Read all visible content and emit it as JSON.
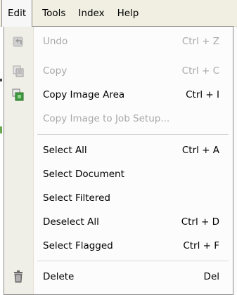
{
  "menubar": {
    "items": [
      {
        "label": "Edit"
      },
      {
        "label": "Tools"
      },
      {
        "label": "Index"
      },
      {
        "label": "Help"
      }
    ]
  },
  "edit_menu": {
    "items": [
      {
        "label": "Undo",
        "shortcut": "Ctrl + Z",
        "enabled": false,
        "icon": "undo-icon"
      },
      {
        "label": "Copy",
        "shortcut": "Ctrl + C",
        "enabled": false,
        "icon": "copy-icon"
      },
      {
        "label": "Copy Image Area",
        "shortcut": "Ctrl + I",
        "enabled": true,
        "icon": "copy-image-area-icon"
      },
      {
        "label": "Copy Image to Job Setup...",
        "shortcut": "",
        "enabled": false
      },
      {
        "label": "Select All",
        "shortcut": "Ctrl + A",
        "enabled": true
      },
      {
        "label": "Select Document",
        "shortcut": "",
        "enabled": true
      },
      {
        "label": "Select Filtered",
        "shortcut": "",
        "enabled": true
      },
      {
        "label": "Deselect All",
        "shortcut": "Ctrl + D",
        "enabled": true
      },
      {
        "label": "Select Flagged",
        "shortcut": "Ctrl + F",
        "enabled": true
      },
      {
        "label": "Delete",
        "shortcut": "Del",
        "enabled": true,
        "icon": "trash-icon"
      }
    ]
  },
  "colors": {
    "menubar_bg": "#f1efe2",
    "icon_column_bg": "#f0efe7",
    "disabled_text": "#a8a8a8",
    "separator": "#d6d6d6"
  }
}
